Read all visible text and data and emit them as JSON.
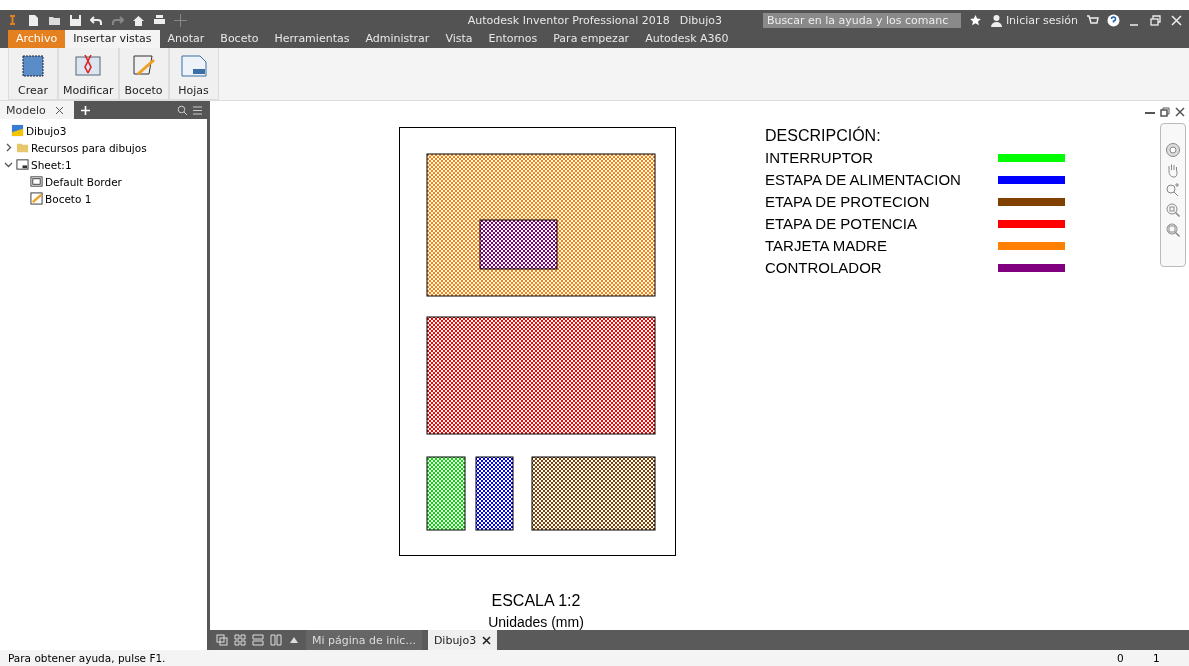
{
  "title_bar": {
    "app_title": "Autodesk Inventor Professional 2018",
    "document": "Dibujo3",
    "search": {
      "placeholder": "Buscar en la ayuda y los comanc"
    },
    "sign_in": "Iniciar sesión"
  },
  "ribbon_tabs": [
    {
      "label": "Archivo",
      "kind": "file",
      "selected": false
    },
    {
      "label": "Insertar vistas",
      "kind": "tab",
      "selected": true
    },
    {
      "label": "Anotar",
      "kind": "tab",
      "selected": false
    },
    {
      "label": "Boceto",
      "kind": "tab",
      "selected": false
    },
    {
      "label": "Herramientas",
      "kind": "tab",
      "selected": false
    },
    {
      "label": "Administrar",
      "kind": "tab",
      "selected": false
    },
    {
      "label": "Vista",
      "kind": "tab",
      "selected": false
    },
    {
      "label": "Entornos",
      "kind": "tab",
      "selected": false
    },
    {
      "label": "Para empezar",
      "kind": "tab",
      "selected": false
    },
    {
      "label": "Autodesk A360",
      "kind": "tab",
      "selected": false
    }
  ],
  "ribbon_buttons": [
    {
      "label": "Crear",
      "kind": "create"
    },
    {
      "label": "Modificar",
      "kind": "modify"
    },
    {
      "label": "Boceto",
      "kind": "sketch"
    },
    {
      "label": "Hojas",
      "kind": "sheets"
    }
  ],
  "browser": {
    "tab": "Modelo",
    "tree": [
      {
        "label": "Dibujo3",
        "kind": "drawing",
        "children": [
          {
            "label": "Recursos para dibujos",
            "kind": "folder",
            "expanded": false
          },
          {
            "label": "Sheet:1",
            "kind": "sheet",
            "expanded": true,
            "children": [
              {
                "label": "Default Border",
                "kind": "border"
              },
              {
                "label": "Boceto 1",
                "kind": "sketch"
              }
            ]
          }
        ]
      }
    ]
  },
  "drawing": {
    "regions": [
      {
        "color": "#ff8000"
      },
      {
        "color": "#800080"
      },
      {
        "color": "#ff0000"
      },
      {
        "color": "#00e000"
      },
      {
        "color": "#0000ff"
      },
      {
        "color": "#804000"
      }
    ],
    "legend_title": "DESCRIPCIÓN:",
    "legend": [
      {
        "label": "INTERRUPTOR",
        "color": "#00ff00"
      },
      {
        "label": "ESTAPA DE ALIMENTACION",
        "color": "#0000ff"
      },
      {
        "label": "ETAPA DE PROTECION",
        "color": "#804000"
      },
      {
        "label": "ETAPA DE POTENCIA",
        "color": "#ff0000"
      },
      {
        "label": "TARJETA MADRE",
        "color": "#ff8000"
      },
      {
        "label": "CONTROLADOR",
        "color": "#800080"
      }
    ],
    "scale": "ESCALA 1:2",
    "units": "Unidades (mm)"
  },
  "document_tabs": [
    {
      "label": "Mi página de inic...",
      "selected": false
    },
    {
      "label": "Dibujo3",
      "selected": true
    }
  ],
  "status_bar": {
    "message": "Para obtener ayuda, pulse F1.",
    "values": [
      "0",
      "1"
    ]
  }
}
